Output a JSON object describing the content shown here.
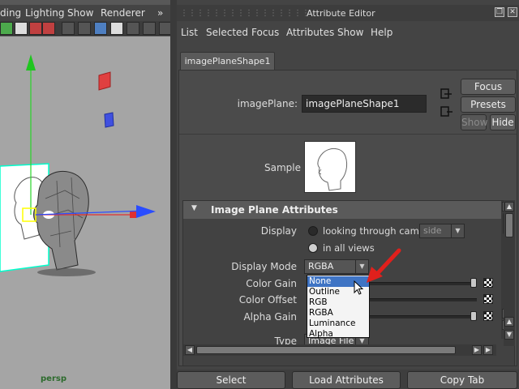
{
  "viewport": {
    "menus": [
      "ding",
      "Lighting",
      "Show",
      "Renderer"
    ],
    "overflow": "»",
    "camera_label": "persp"
  },
  "attribute_editor": {
    "title": "Attribute Editor",
    "menus": [
      "List",
      "Selected",
      "Focus",
      "Attributes",
      "Show",
      "Help"
    ],
    "tab": "imagePlaneShape1",
    "image_plane_label": "imagePlane:",
    "image_plane_value": "imagePlaneShape1",
    "buttons": {
      "focus": "Focus",
      "presets": "Presets",
      "show": "Show",
      "hide": "Hide"
    },
    "sample_label": "Sample",
    "section_title": "Image Plane Attributes",
    "display_label": "Display",
    "display_option_camera": "looking through camera",
    "display_camera_value": "side",
    "display_option_all": "in all views",
    "display_mode_label": "Display Mode",
    "display_mode_value": "RGBA",
    "color_gain_label": "Color Gain",
    "color_offset_label": "Color Offset",
    "alpha_gain_label": "Alpha Gain",
    "type_label": "Type",
    "type_value": "Image File",
    "display_mode_options": [
      "None",
      "Outline",
      "RGB",
      "RGBA",
      "Luminance",
      "Alpha"
    ],
    "highlighted_option": "None",
    "bottom_buttons": {
      "select": "Select",
      "load": "Load Attributes",
      "copy": "Copy Tab"
    }
  },
  "colors": {
    "highlight": "#3f74c4",
    "arrow": "#e0201c"
  }
}
